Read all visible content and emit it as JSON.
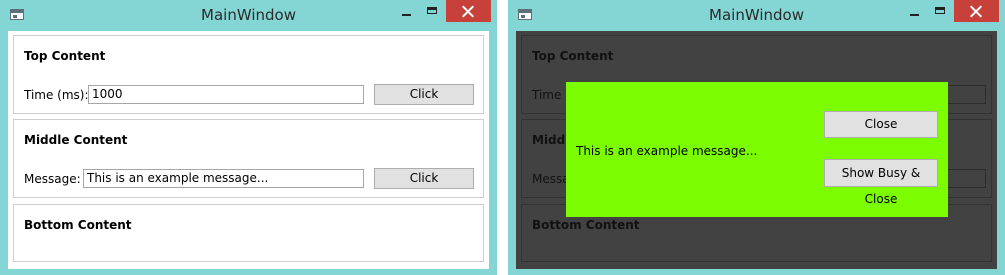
{
  "left_window": {
    "title": "MainWindow",
    "top": {
      "title": "Top Content",
      "label": "Time (ms):",
      "value": "1000",
      "button": "Click"
    },
    "middle": {
      "title": "Middle Content",
      "label": "Message:",
      "value": "This is an example message...",
      "button": "Click"
    },
    "bottom": {
      "title": "Bottom Content"
    }
  },
  "right_window": {
    "title": "MainWindow",
    "top": {
      "title": "Top Content",
      "label": "Time ("
    },
    "middle": {
      "title": "Middl",
      "label": "Messa"
    },
    "bottom": {
      "title": "Bottom Content"
    },
    "dialog": {
      "message": "This is an example message...",
      "close_button": "Close",
      "busy_close_button": "Show Busy & Close"
    }
  },
  "colors": {
    "window_frame": "#84d6d4",
    "close_button": "#c7403a",
    "dim_overlay": "#424242",
    "dialog_background": "#7cfc00"
  }
}
